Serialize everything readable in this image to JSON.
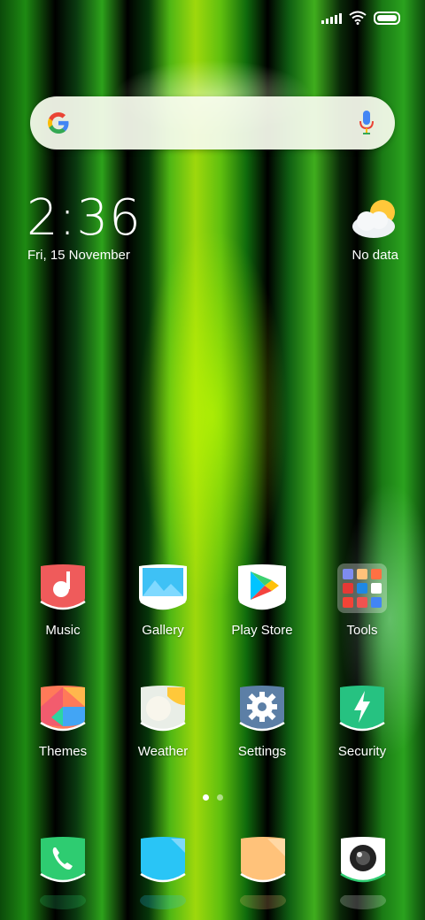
{
  "home_screen": {
    "clock": {
      "time": "2:36",
      "date": "Fri, 15 November"
    },
    "weather": {
      "label": "No data",
      "icon": "cloud-sun-icon"
    },
    "search": {
      "icons": [
        "google-g-icon",
        "microphone-icon"
      ]
    },
    "apps": [
      {
        "label": "Music",
        "icon": "music-note-icon",
        "color": "#EF5350"
      },
      {
        "label": "Gallery",
        "icon": "mountain-picture-icon",
        "color": "#29B6F6"
      },
      {
        "label": "Play Store",
        "icon": "play-triangle-icon",
        "color": "#FFFFFF"
      },
      {
        "label": "Tools",
        "icon": "folder-grid-icon",
        "color": "#4CAF50"
      },
      {
        "label": "Themes",
        "icon": "color-palette-icon",
        "color": "#FF7043"
      },
      {
        "label": "Weather",
        "icon": "sun-cloud-icon",
        "color": "#FFC107"
      },
      {
        "label": "Settings",
        "icon": "gear-icon",
        "color": "#5C7FA6"
      },
      {
        "label": "Security",
        "icon": "lightning-shield-icon",
        "color": "#26C281"
      }
    ],
    "dock": [
      {
        "icon": "phone-icon",
        "color": "#2ECC71"
      },
      {
        "icon": "chat-bubble-icon",
        "color": "#29C5F6"
      },
      {
        "icon": "message-icon",
        "color": "#FFC27A"
      },
      {
        "icon": "camera-lens-icon",
        "color": "#FFFFFF"
      }
    ],
    "page_indicator": {
      "pages": 2,
      "current": 1
    }
  }
}
